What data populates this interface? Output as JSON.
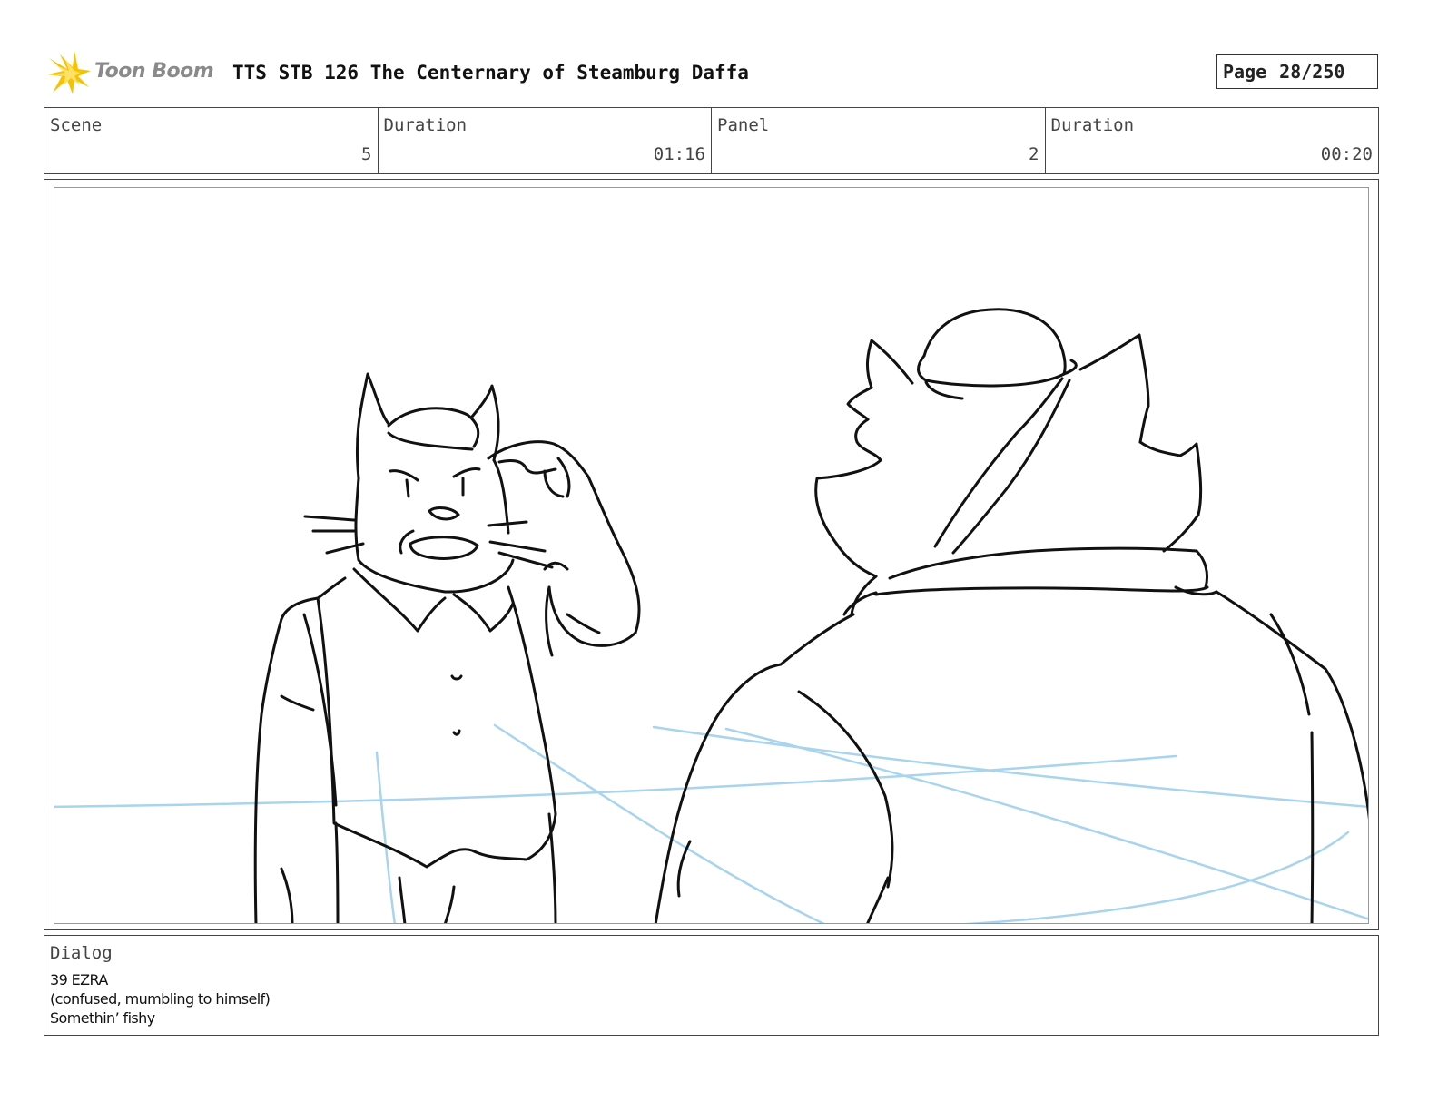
{
  "header": {
    "logo_text": "Toon Boom",
    "title": "TTS STB 126 The Centernary of Steamburg Daffa",
    "page_label": "Page",
    "page_number": "28/250"
  },
  "info": {
    "scene_label": "Scene",
    "scene_value": "5",
    "scene_duration_label": "Duration",
    "scene_duration_value": "01:16",
    "panel_label": "Panel",
    "panel_value": "2",
    "panel_duration_label": "Duration",
    "panel_duration_value": "00:20"
  },
  "dialog": {
    "label": "Dialog",
    "lines": [
      "39 EZRA",
      "(confused, mumbling to himself)",
      "Somethin’ fishy"
    ]
  },
  "icons": {
    "logo": "toon-boom-burst-icon"
  },
  "colors": {
    "logo_burst": "#f5c400",
    "logo_text": "#8a8a8a",
    "sketch_line": "#111111",
    "guide_line": "#a9d4ee"
  }
}
